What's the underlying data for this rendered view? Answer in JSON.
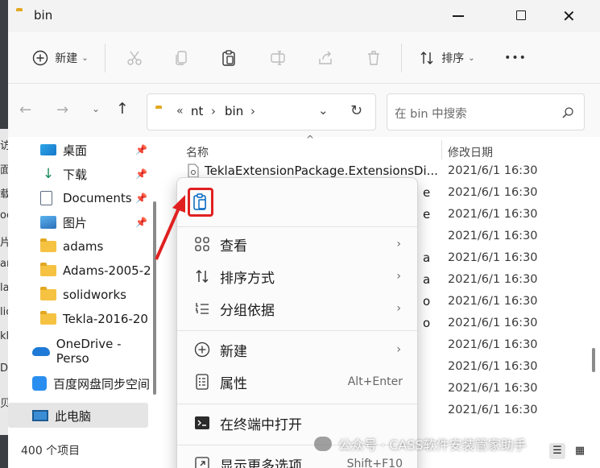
{
  "window": {
    "title": "bin"
  },
  "left_strip": {
    "chars": [
      "访",
      "面",
      "载",
      "oc",
      "片",
      "am",
      "la",
      "lic",
      "kl",
      "D",
      "贝"
    ]
  },
  "toolbar": {
    "new_label": "新建",
    "sort_label": "排序",
    "more_label": "•••"
  },
  "address": {
    "sep": "«",
    "crumbs": [
      "nt",
      "bin"
    ],
    "chevron": "›"
  },
  "search": {
    "placeholder": "在 bin 中搜索"
  },
  "sidebar": {
    "items": [
      {
        "label": "桌面",
        "pinned": true
      },
      {
        "label": "下载",
        "pinned": true
      },
      {
        "label": "Documents",
        "pinned": true
      },
      {
        "label": "图片",
        "pinned": true
      },
      {
        "label": "adams"
      },
      {
        "label": "Adams-2005-2"
      },
      {
        "label": "solidworks"
      },
      {
        "label": "Tekla-2016-20"
      },
      {
        "label": "OneDrive - Perso"
      },
      {
        "label": "百度网盘同步空间"
      },
      {
        "label": "此电脑"
      }
    ]
  },
  "columns": {
    "name": "名称",
    "date": "修改日期"
  },
  "files": [
    {
      "name": "TeklaExtensionPackage.ExtensionsDi...",
      "date": "2021/6/1 16:30"
    },
    {
      "name": "e",
      "date": "2021/6/1 16:30"
    },
    {
      "name": "e",
      "date": "2021/6/1 16:30"
    },
    {
      "name": "",
      "date": "2021/6/1 16:30"
    },
    {
      "name": "a",
      "date": "2021/6/1 16:30"
    },
    {
      "name": "a",
      "date": "2021/6/1 16:30"
    },
    {
      "name": "o",
      "date": "2021/6/1 16:30"
    },
    {
      "name": "o",
      "date": "2021/6/1 16:30"
    },
    {
      "name": "",
      "date": "2021/6/1 16:30"
    },
    {
      "name": "",
      "date": "2021/6/1 16:30"
    },
    {
      "name": "",
      "date": "2021/6/1 16:30"
    },
    {
      "name": "",
      "date": "2021/6/1 16:30"
    }
  ],
  "context_menu": {
    "items": [
      {
        "label": "查看",
        "submenu": true
      },
      {
        "label": "排序方式",
        "submenu": true
      },
      {
        "label": "分组依据",
        "submenu": true
      },
      {
        "label": "新建",
        "submenu": true
      },
      {
        "label": "属性",
        "shortcut": "Alt+Enter"
      },
      {
        "label": "在终端中打开"
      },
      {
        "label": "显示更多选项",
        "shortcut": "Shift+F10"
      }
    ]
  },
  "status": {
    "count": "400 个项目"
  },
  "watermark": {
    "text": "公众号 · CASS软件安装管家助手"
  },
  "colors": {
    "highlight": "#e02020",
    "folder": "#f5c242",
    "accent": "#0067c0"
  }
}
